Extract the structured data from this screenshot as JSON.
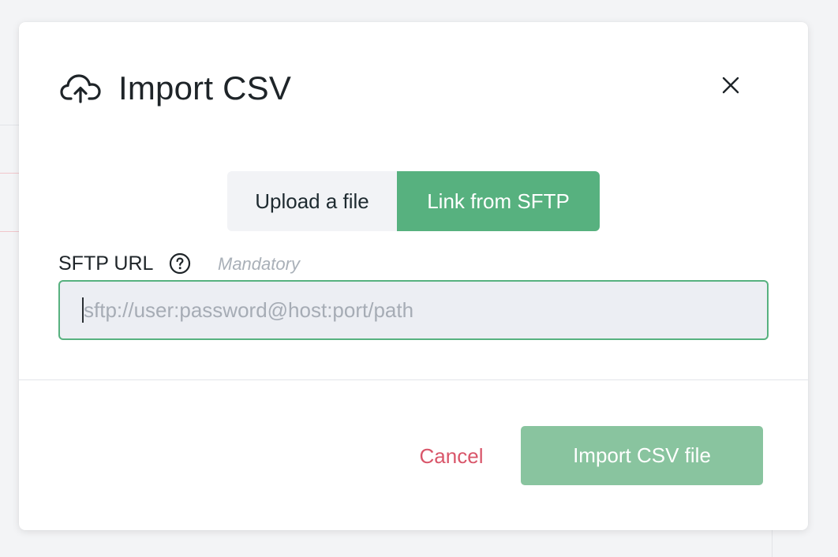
{
  "dialog": {
    "title": "Import CSV",
    "title_icon": "cloud-upload-icon",
    "close_icon": "close-icon"
  },
  "source_toggle": {
    "options": [
      {
        "label": "Upload a file",
        "selected": false
      },
      {
        "label": "Link from SFTP",
        "selected": true
      }
    ]
  },
  "sftp_field": {
    "label": "SFTP URL",
    "help_icon": "question-circle-icon",
    "requirement": "Mandatory",
    "placeholder": "sftp://user:password@host:port/path",
    "value": ""
  },
  "footer": {
    "cancel_label": "Cancel",
    "submit_label": "Import CSV file"
  },
  "colors": {
    "accent_green": "#57b17f",
    "disabled_green": "#89c49f",
    "danger_red": "#d9566a"
  }
}
